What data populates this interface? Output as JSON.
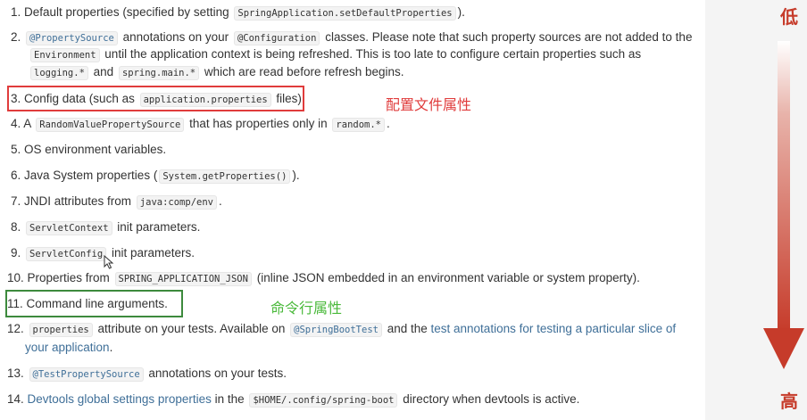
{
  "items": [
    {
      "parts": [
        {
          "t": "text",
          "v": "1. Default properties (specified by setting "
        },
        {
          "t": "code",
          "v": "SpringApplication.setDefaultProperties"
        },
        {
          "t": "text",
          "v": ")."
        }
      ]
    },
    {
      "parts": [
        {
          "t": "text",
          "v": "2. "
        },
        {
          "t": "code",
          "v": "@PropertySource",
          "cls": "blue"
        },
        {
          "t": "text",
          "v": " annotations on your "
        },
        {
          "t": "code",
          "v": "@Configuration"
        },
        {
          "t": "text",
          "v": " classes. Please note that such property sources are not added to the"
        }
      ]
    },
    {
      "parts": [
        {
          "t": "code",
          "v": "Environment"
        },
        {
          "t": "text",
          "v": " until the application context is being refreshed. This is too late to configure certain properties such as"
        }
      ]
    },
    {
      "parts": [
        {
          "t": "code",
          "v": "logging.*"
        },
        {
          "t": "text",
          "v": " and "
        },
        {
          "t": "code",
          "v": "spring.main.*"
        },
        {
          "t": "text",
          "v": " which are read before refresh begins."
        }
      ]
    },
    {
      "parts": [
        {
          "t": "text",
          "v": "3. Config data (such as "
        },
        {
          "t": "code",
          "v": "application.properties"
        },
        {
          "t": "text",
          "v": " files)"
        }
      ]
    },
    {
      "parts": [
        {
          "t": "text",
          "v": "4. A "
        },
        {
          "t": "code",
          "v": "RandomValuePropertySource"
        },
        {
          "t": "text",
          "v": " that has properties only in "
        },
        {
          "t": "code",
          "v": "random.*"
        },
        {
          "t": "text",
          "v": "."
        }
      ]
    },
    {
      "parts": [
        {
          "t": "text",
          "v": "5. OS environment variables."
        }
      ]
    },
    {
      "parts": [
        {
          "t": "text",
          "v": "6. Java System properties ("
        },
        {
          "t": "code",
          "v": "System.getProperties()"
        },
        {
          "t": "text",
          "v": ")."
        }
      ]
    },
    {
      "parts": [
        {
          "t": "text",
          "v": "7. JNDI attributes from "
        },
        {
          "t": "code",
          "v": "java:comp/env"
        },
        {
          "t": "text",
          "v": "."
        }
      ]
    },
    {
      "parts": [
        {
          "t": "text",
          "v": "8. "
        },
        {
          "t": "code",
          "v": "ServletContext"
        },
        {
          "t": "text",
          "v": " init parameters."
        }
      ]
    },
    {
      "parts": [
        {
          "t": "text",
          "v": "9. "
        },
        {
          "t": "code",
          "v": "ServletConfig"
        },
        {
          "t": "text",
          "v": " init parameters."
        }
      ]
    },
    {
      "parts": [
        {
          "t": "text",
          "v": "10. Properties from "
        },
        {
          "t": "code",
          "v": "SPRING_APPLICATION_JSON"
        },
        {
          "t": "text",
          "v": " (inline JSON embedded in an environment variable or system property)."
        }
      ]
    },
    {
      "parts": [
        {
          "t": "text",
          "v": "11. Command line arguments."
        }
      ]
    },
    {
      "parts": [
        {
          "t": "text",
          "v": "12. "
        },
        {
          "t": "code",
          "v": "properties"
        },
        {
          "t": "text",
          "v": " attribute on your tests. Available on "
        },
        {
          "t": "code",
          "v": "@SpringBootTest",
          "cls": "blue"
        },
        {
          "t": "text",
          "v": " and the "
        },
        {
          "t": "link",
          "v": "test annotations for testing a particular slice of"
        }
      ]
    },
    {
      "parts": [
        {
          "t": "link",
          "v": "your application"
        },
        {
          "t": "text",
          "v": "."
        }
      ]
    },
    {
      "parts": [
        {
          "t": "text",
          "v": "13. "
        },
        {
          "t": "code",
          "v": "@TestPropertySource",
          "cls": "blue"
        },
        {
          "t": "text",
          "v": " annotations on your tests."
        }
      ]
    },
    {
      "parts": [
        {
          "t": "text",
          "v": "14. "
        },
        {
          "t": "link",
          "v": "Devtools global settings properties"
        },
        {
          "t": "text",
          "v": " in the "
        },
        {
          "t": "code",
          "v": "$HOME/.config/spring-boot"
        },
        {
          "t": "text",
          "v": " directory when devtools is active."
        }
      ]
    }
  ],
  "annotations": {
    "config_note": "配置文件属性",
    "cmd_note": "命令行属性",
    "low_label": "低",
    "high_label": "高"
  },
  "colors": {
    "red_box": "#e03c3c",
    "green_box": "#3d8a3d",
    "green_note": "#49b93a",
    "arrow": "#c63b2a",
    "link": "#3f6f98"
  }
}
